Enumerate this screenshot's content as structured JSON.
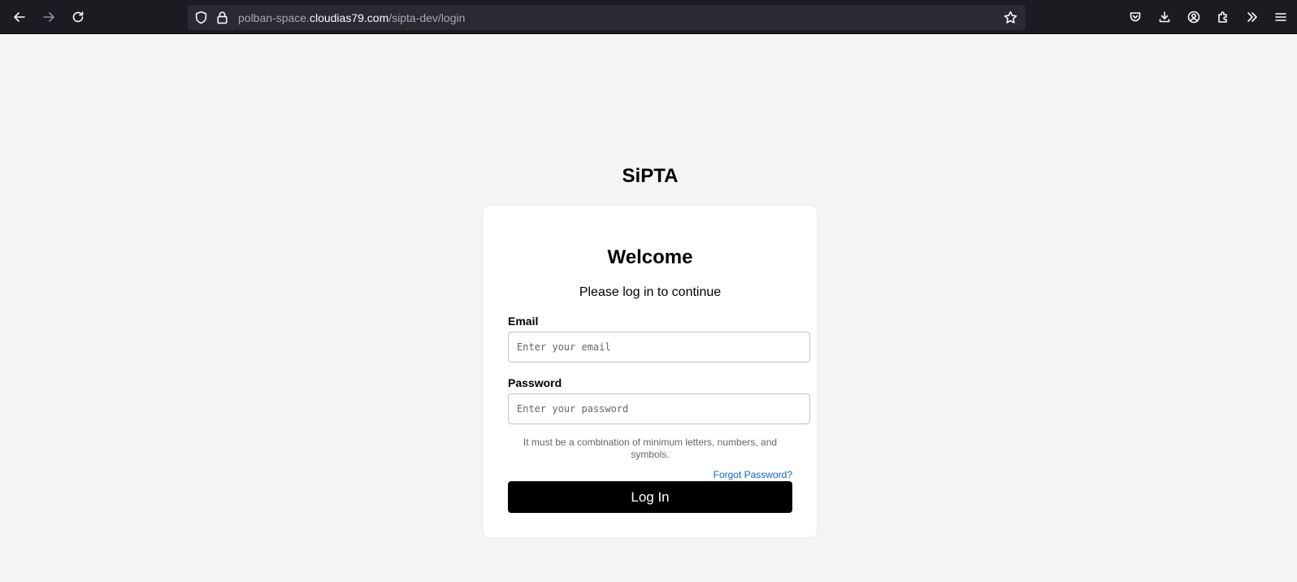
{
  "browser": {
    "url_prefix": "polban-space.",
    "url_host": "cloudias79.com",
    "url_path": "/sipta-dev/login",
    "icons": [
      "back-icon",
      "forward-icon",
      "reload-icon",
      "shield-icon",
      "lock-icon",
      "star-icon",
      "pocket-icon",
      "download-icon",
      "account-icon",
      "extensions-icon",
      "chevron-double-right-icon",
      "menu-icon"
    ]
  },
  "page": {
    "app_title": "SiPTA",
    "welcome": "Welcome",
    "subtitle": "Please log in to continue",
    "email_label": "Email",
    "email_value": "",
    "email_placeholder": "Enter your email",
    "password_label": "Password",
    "password_value": "",
    "password_placeholder": "Enter your password",
    "password_hint": "It must be a combination of minimum letters, numbers, and symbols.",
    "forgot_password": "Forgot Password?",
    "login_button": "Log In"
  },
  "colors": {
    "toolbar_bg": "#1c1b22",
    "page_bg": "#f4f4f4",
    "button_bg": "#000000",
    "link": "#0a66d8"
  }
}
